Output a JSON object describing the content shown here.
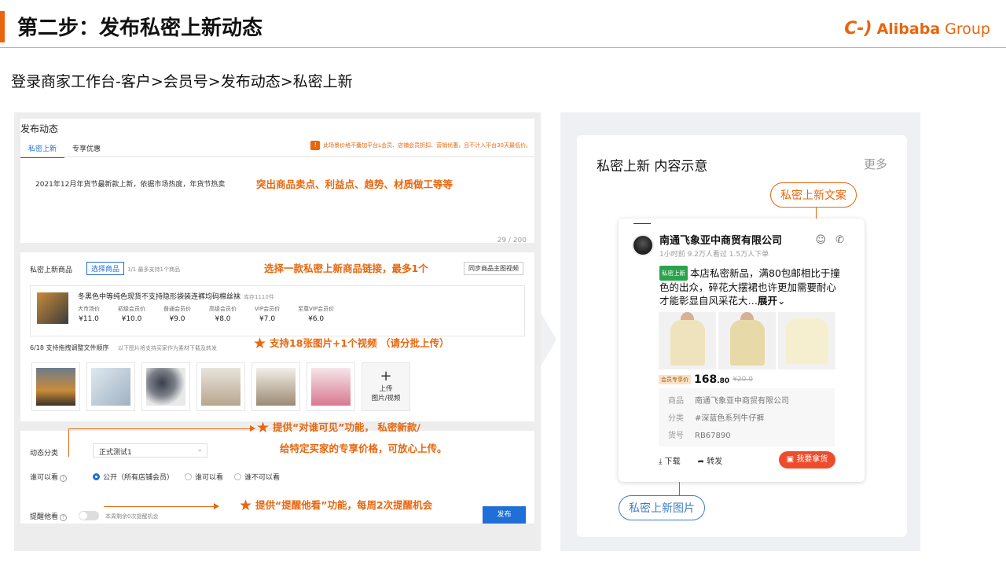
{
  "slide": {
    "title": "第二步：发布私密上新动态",
    "brand": {
      "symbol": "C-)",
      "name": "Alibaba",
      "group": "Group"
    },
    "breadcrumb": "登录商家工作台-客户>会员号>发布动态>私密上新",
    "accent_color": "#e8660d",
    "link_color": "#1f6fd6"
  },
  "left": {
    "panel_title": "发布动态",
    "tabs": [
      {
        "label": "私密上新",
        "active": true
      },
      {
        "label": "专享优惠",
        "active": false
      }
    ],
    "notice_icon": "info-icon",
    "notice": "此场景价格不叠加平台L会员、店铺会员折扣、营销优惠，且不计入平台30天最低价。",
    "content_text": "2021年12月年货节最新款上新，依据市场热度，年货节热卖",
    "char_count": "29 / 200",
    "product_section": {
      "label": "私密上新商品",
      "select_button": "选择商品",
      "limit": "1/1 最多支持1个商品",
      "sync_button": "同步商品主图视频",
      "product": {
        "name": "冬黑色中等纯色现货不支持隐形袋装连裤均码棉丝袜",
        "stock": "库存1110件",
        "prices": [
          {
            "label": "大市场价",
            "value": "¥11.0"
          },
          {
            "label": "初级会员价",
            "value": "¥10.0"
          },
          {
            "label": "普通会员价",
            "value": "¥9.0"
          },
          {
            "label": "高级会员价",
            "value": "¥8.0"
          },
          {
            "label": "VIP会员价",
            "value": "¥7.0"
          },
          {
            "label": "至尊VIP会员价",
            "value": "¥6.0"
          }
        ]
      }
    },
    "images": {
      "counter": "6/18 支持拖拽调整文件顺序",
      "hint": "以下图片将支持买家作为素材下载及转发",
      "upload_label_1": "上传",
      "upload_label_2": "图片/视频"
    },
    "category": {
      "label": "动态分类",
      "value": "正式测试1"
    },
    "visibility": {
      "label": "谁可以看",
      "options": [
        {
          "label": "公开（所有店铺会员）",
          "checked": true
        },
        {
          "label": "谁可以看",
          "checked": false
        },
        {
          "label": "谁不可以看",
          "checked": false
        }
      ]
    },
    "remind": {
      "label": "提醒他看",
      "hint": "本周剩余0次提醒机会"
    },
    "publish_button": "发布"
  },
  "annotations": {
    "a1": "突出商品卖点、利益点、趋势、材质做工等等",
    "a2": "选择一款私密上新商品链接，最多1个",
    "a3": "支持18张图片+1个视频 （请分批上传）",
    "a4_line1": "提供“对谁可见”功能，  私密新款/",
    "a4_line2": "给特定买家的专享价格，可放心上传。",
    "a5": "提供“提醒他看”功能，每周2次提醒机会"
  },
  "right": {
    "title": "私密上新 内容示意",
    "more": "更多",
    "pill_copy": "私密上新文案",
    "pill_image": "私密上新图片",
    "post": {
      "shop_name": "南通飞象亚中商贸有限公司",
      "meta": "1小时前   9.2万人看过   1.5万人下单",
      "tag": "私密上新",
      "text": "本店私密新品，满80包邮相比于撞色的出众，碎花大摆裙也许更加需要耐心才能彰显自风采花大…",
      "expand": "展开",
      "member_tag": "会员专享价",
      "price_int": "168",
      "price_dec": ".80",
      "price_old": "¥20.0",
      "info": [
        {
          "key": "商品",
          "value": "南通飞象亚中商贸有限公司"
        },
        {
          "key": "分类",
          "value": "#深蓝色系列牛仔裤"
        },
        {
          "key": "货号",
          "value": "RB67890"
        }
      ],
      "download": "下载",
      "share": "转发",
      "want": "我要拿货"
    }
  }
}
